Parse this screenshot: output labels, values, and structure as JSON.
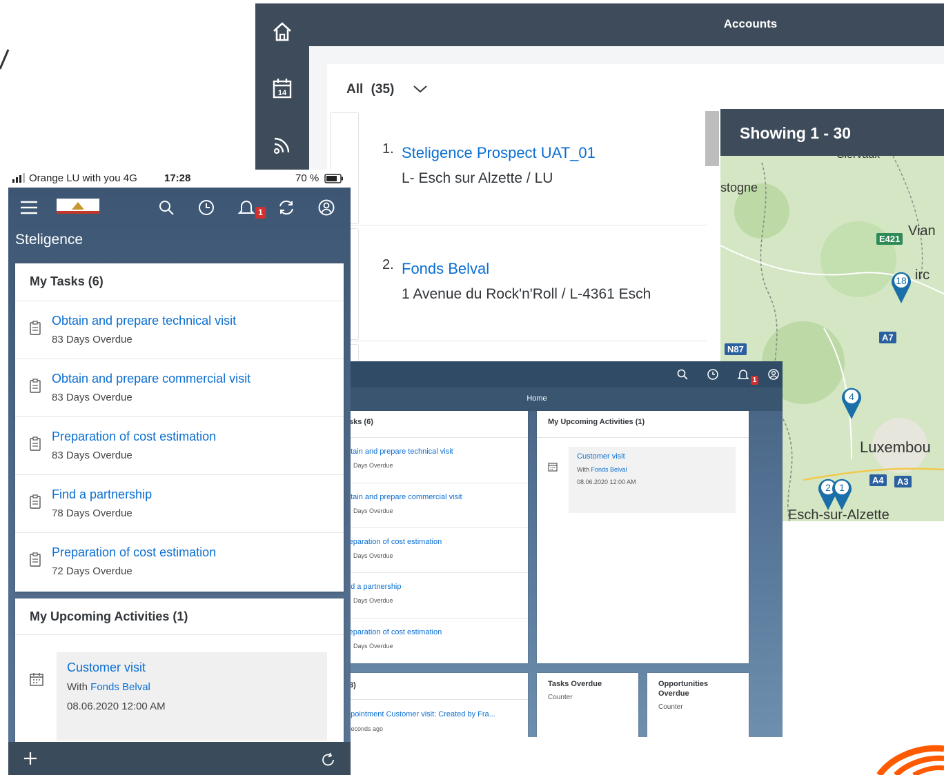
{
  "accounts": {
    "title": "Accounts",
    "filter_label": "All",
    "filter_count": "(35)",
    "rail_icons": [
      "home-icon",
      "calendar-icon",
      "feed-icon"
    ],
    "rail_calendar_day": "14",
    "items": [
      {
        "number": "1.",
        "name": "Steligence Prospect UAT_01",
        "address": "L- Esch sur Alzette / LU"
      },
      {
        "number": "2.",
        "name": "Fonds Belval",
        "address": "1 Avenue du Rock'n'Roll / L-4361 Esch"
      }
    ],
    "map": {
      "showing": "Showing 1 - 30",
      "labels": {
        "top": "Clervaux",
        "bastogne": "stogne",
        "vianden": "Vian",
        "diekirch": "irc",
        "luxembourg": "Luxembou",
        "esch": "Esch-sur-Alzette"
      },
      "roads": {
        "e421": "E421",
        "a7": "A7",
        "n87": "N87",
        "a4": "A4",
        "a3": "A3"
      },
      "pins": [
        "18",
        "4",
        "2",
        "1"
      ],
      "pin_color": "#1a6fa8"
    }
  },
  "desktop": {
    "home_label": "Home",
    "badge": "1",
    "tasks_card": {
      "title": "sks (6)",
      "items": [
        {
          "title": "btain and prepare technical visit",
          "sub": "Days Overdue"
        },
        {
          "title": "btain and prepare commercial visit",
          "sub": "Days Overdue"
        },
        {
          "title": "reparation of cost estimation",
          "sub": "Days Overdue"
        },
        {
          "title": "nd a partnership",
          "sub": "Days Overdue"
        },
        {
          "title": "reparation of cost estimation",
          "sub": "Days Overdue"
        }
      ]
    },
    "activities_card": {
      "title": "My Upcoming Activities (1)",
      "activity_title": "Customer visit",
      "with_label": "With",
      "with_name": "Fonds Belval",
      "date": "08.06.2020 12:00 AM"
    },
    "feed_card": {
      "title": "3)",
      "item": "ppointment Customer visit: Created by Fra...",
      "time": "seconds ago"
    },
    "tasks_overdue": {
      "title": "Tasks Overdue",
      "sub": "Counter"
    },
    "opps_overdue": {
      "title_line1": "Opportunities",
      "title_line2": "Overdue",
      "sub": "Counter"
    }
  },
  "mobile": {
    "status": {
      "carrier": "Orange LU with you  4G",
      "time": "17:28",
      "battery": "70 %"
    },
    "badge": "1",
    "company": "Steligence",
    "tasks_title": "My Tasks (6)",
    "tasks": [
      {
        "title": "Obtain and prepare technical visit",
        "sub": "83 Days Overdue"
      },
      {
        "title": "Obtain and prepare commercial visit",
        "sub": "83 Days Overdue"
      },
      {
        "title": "Preparation of cost estimation",
        "sub": "83 Days Overdue"
      },
      {
        "title": "Find a partnership",
        "sub": "78 Days Overdue"
      },
      {
        "title": "Preparation of cost estimation",
        "sub": "72 Days Overdue"
      }
    ],
    "activities_title": "My Upcoming Activities (1)",
    "activity": {
      "title": "Customer visit",
      "with_label": "With",
      "with_name": "Fonds Belval",
      "date": "08.06.2020 12:00 AM"
    }
  },
  "colors": {
    "shell": "#3e4b5a",
    "link": "#0a6ed1",
    "badge": "#d32f2f",
    "orange": "#ff5a00"
  }
}
